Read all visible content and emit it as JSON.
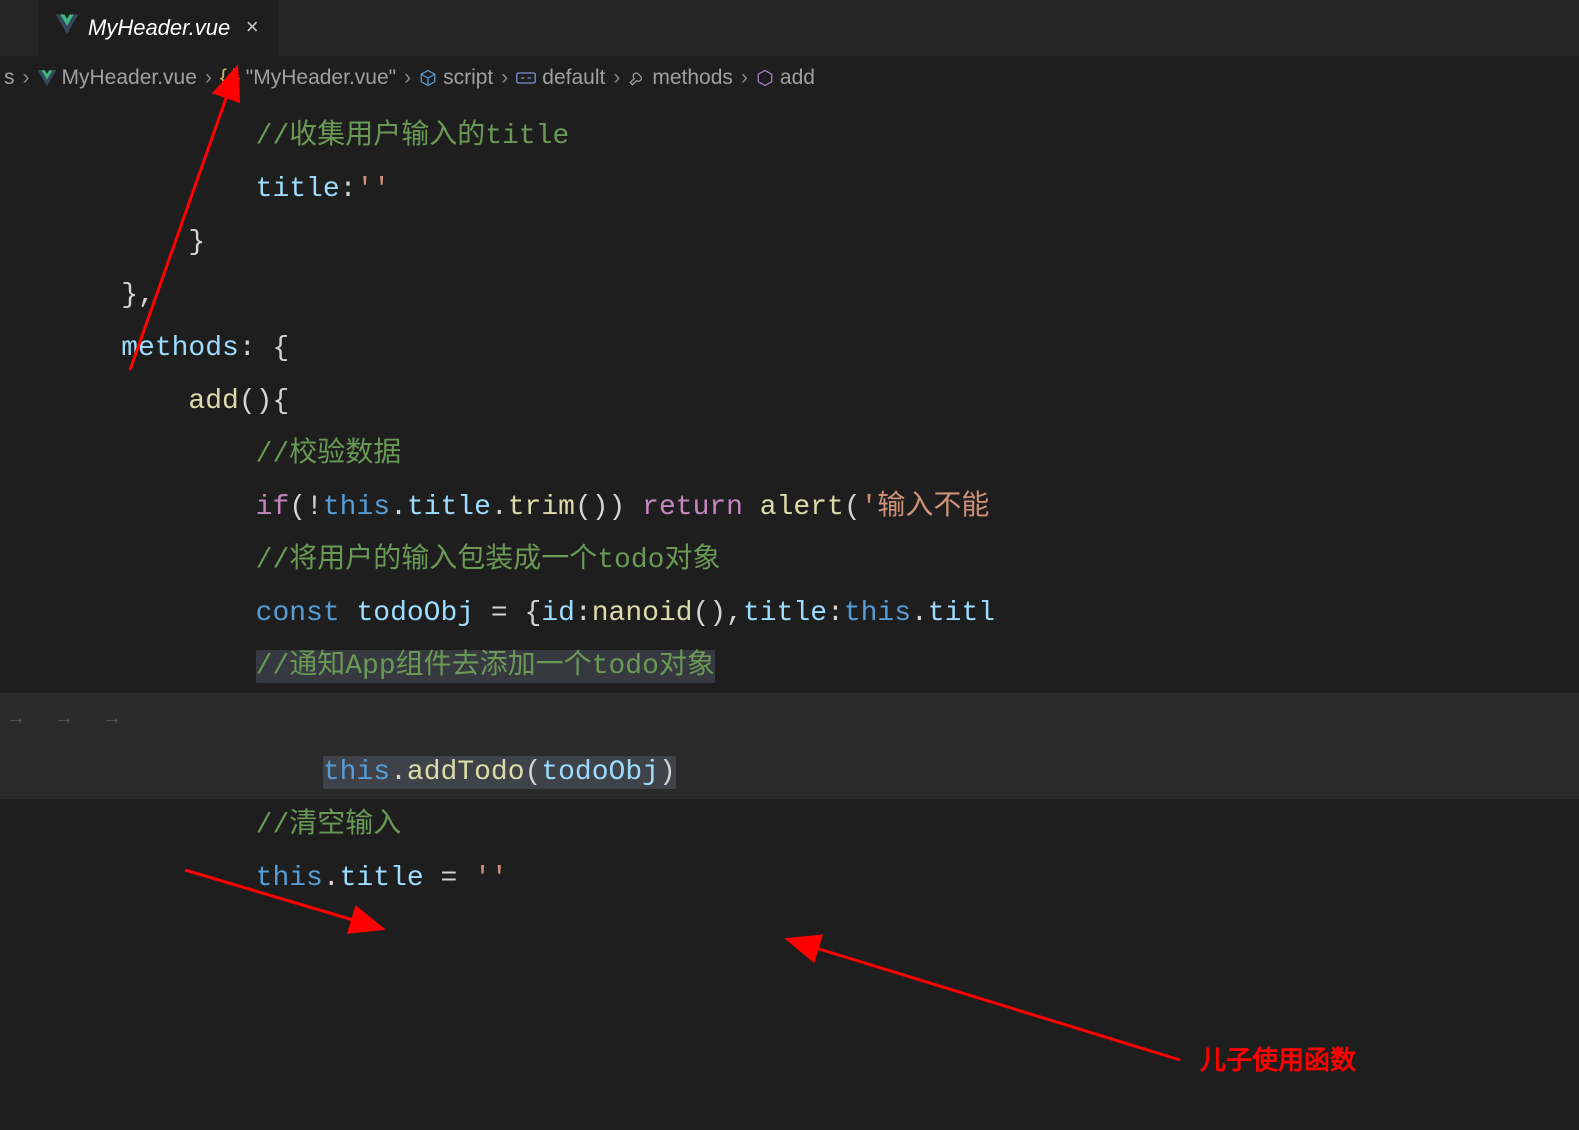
{
  "tab": {
    "title": "MyHeader.vue",
    "close": "×"
  },
  "breadcrumb": {
    "items": [
      {
        "label": "s"
      },
      {
        "label": "MyHeader.vue"
      },
      {
        "label": "\"MyHeader.vue\""
      },
      {
        "label": "script"
      },
      {
        "label": "default"
      },
      {
        "label": "methods"
      },
      {
        "label": "add"
      }
    ]
  },
  "code": {
    "l1_comment": "//收集用户输入的title",
    "l2_prop": "title",
    "l2_colon": ":",
    "l2_str": "''",
    "l3": "}",
    "l4": "},",
    "l5_prop": "methods",
    "l5_after": ": {",
    "l6_func": "add",
    "l6_after": "(){",
    "l7_comment": "//校验数据",
    "l8_if": "if",
    "l8_p1": "(!",
    "l8_this": "this",
    "l8_dot": ".",
    "l8_title": "title",
    "l8_dot2": ".",
    "l8_trim": "trim",
    "l8_p2": "()) ",
    "l8_return": "return",
    "l8_sp": " ",
    "l8_alert": "alert",
    "l8_p3": "(",
    "l8_str": "'输入不能",
    "l9_comment": "//将用户的输入包装成一个todo对象",
    "l10_const": "const",
    "l10_sp": " ",
    "l10_var": "todoObj",
    "l10_eq": " = {",
    "l10_id": "id",
    "l10_c1": ":",
    "l10_nanoid": "nanoid",
    "l10_p": "(),",
    "l10_title": "title",
    "l10_c2": ":",
    "l10_this": "this",
    "l10_d": ".",
    "l10_titl": "titl",
    "l11_comment": "//通知App组件去添加一个todo对象",
    "l12_this": "this",
    "l12_dot": ".",
    "l12_addTodo": "addTodo",
    "l12_p1": "(",
    "l12_arg": "todoObj",
    "l12_p2": ")",
    "l13_comment": "//清空输入",
    "l14_this": "this",
    "l14_dot": ".",
    "l14_title": "title",
    "l14_eq": " = ",
    "l14_str": "''"
  },
  "annotation": {
    "label": "儿子使用函数"
  }
}
